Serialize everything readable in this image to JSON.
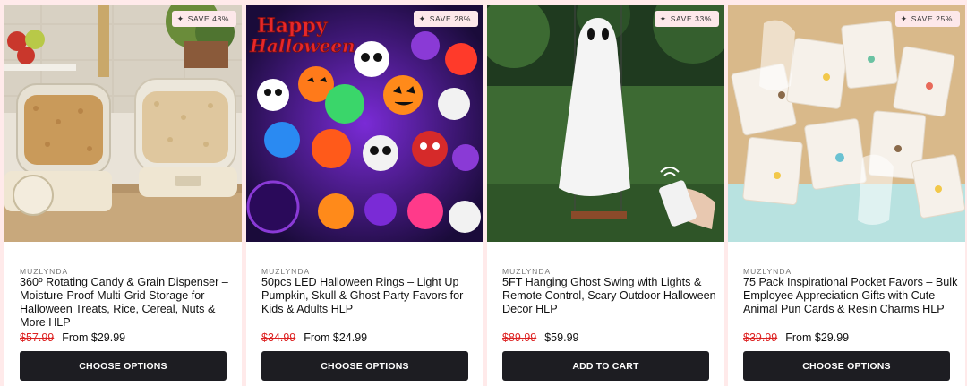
{
  "products": [
    {
      "badge": "SAVE 48%",
      "brand": "MUZLYNDA",
      "title": "360º Rotating Candy & Grain Dispenser – Moisture-Proof Multi-Grid Storage for Halloween Treats, Rice, Cereal, Nuts & More HLP",
      "compare_price": "$57.99",
      "price": "From $29.99",
      "button": "CHOOSE OPTIONS",
      "image": "rotating grain dispensers on kitchen counter"
    },
    {
      "badge": "SAVE 28%",
      "brand": "MUZLYNDA",
      "title": "50pcs LED Halloween Rings – Light Up Pumpkin, Skull & Ghost Party Favors for Kids & Adults HLP",
      "compare_price": "$34.99",
      "price": "From $24.99",
      "button": "CHOOSE OPTIONS",
      "image": "glowing halloween rings collage",
      "image_text": "Happy Halloween"
    },
    {
      "badge": "SAVE 33%",
      "brand": "MUZLYNDA",
      "title": "5FT Hanging Ghost Swing with Lights & Remote Control, Scary Outdoor Halloween Decor HLP",
      "compare_price": "$89.99",
      "price": "$59.99",
      "button": "ADD TO CART",
      "image": "white ghost on a swing in a park with remote"
    },
    {
      "badge": "SAVE 25%",
      "brand": "MUZLYNDA",
      "title": "75 Pack Inspirational Pocket Favors – Bulk Employee Appreciation Gifts with Cute Animal Pun Cards & Resin Charms HLP",
      "compare_price": "$39.99",
      "price": "From $29.99",
      "button": "CHOOSE OPTIONS",
      "image": "organza pouches with pun cards on sand"
    }
  ],
  "colors": {
    "sale": "#d22222",
    "button": "#1d1d22",
    "badge_bg": "#fde8ea",
    "page_bg": "#ffeaea"
  },
  "icons": {
    "badge": "sparkle-icon"
  }
}
